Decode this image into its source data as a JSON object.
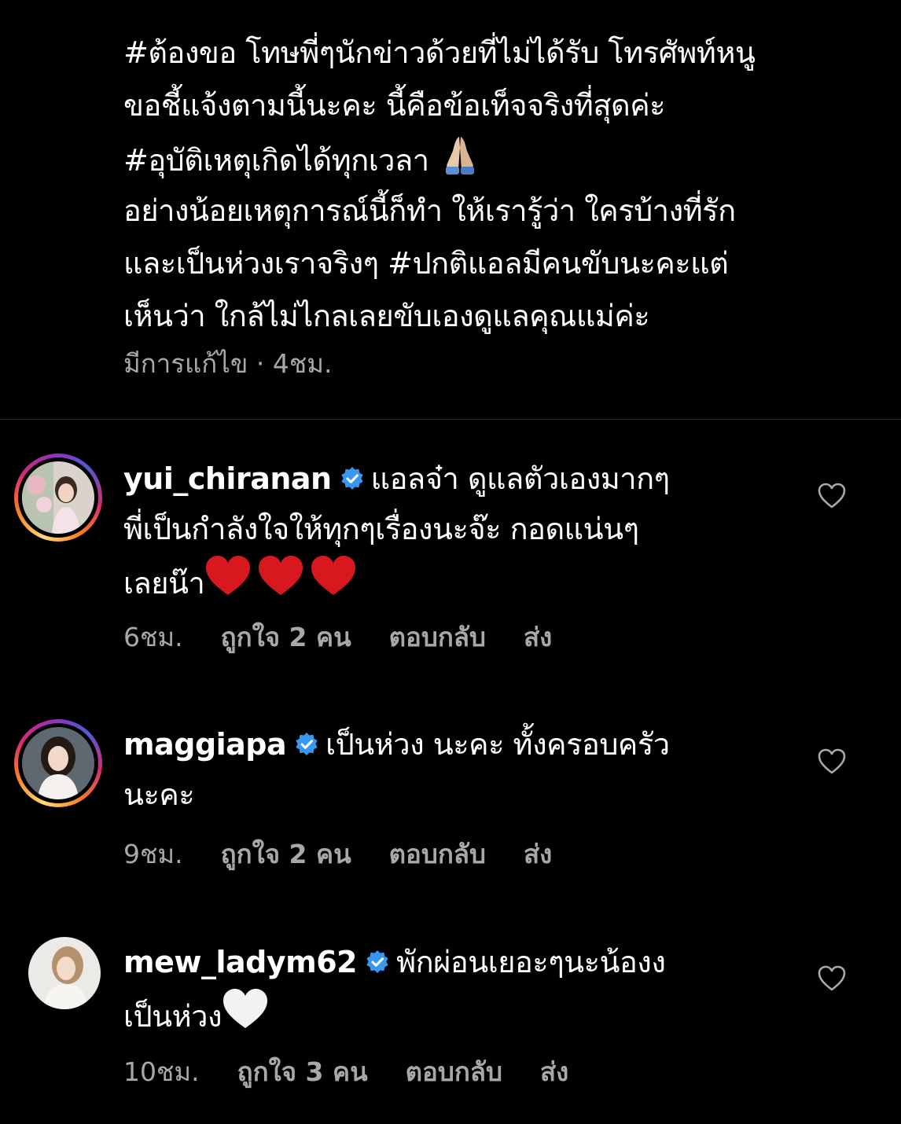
{
  "caption": {
    "lines": [
      "#ต้องขอ โทษพี่ๆนักข่าวด้วยที่ไม่ได้รับ โทรศัพท์หนู",
      "ขอชี้แจ้งตามนี้นะคะ นี้คือข้อเท็จจริงที่สุดค่ะ",
      "#อุบัติเหตุเกิดได้ทุกเวลา",
      "อย่างน้อยเหตุการณ์นี้ก็ทำ ให้เรารู้ว่า ใครบ้างที่รัก",
      "และเป็นห่วงเราจริงๆ #ปกติแอลมีคนขับนะคะแต่",
      "เห็นว่า ใกล้ไม่ไกลเลยขับเองดูแลคุณแม่ค่ะ"
    ],
    "emoji": "folded-hands",
    "meta": "มีการแก้ไข · 4ชม."
  },
  "comments": [
    {
      "username": "yui_chiranan",
      "verified": true,
      "line1": "แอลจ๋า ดูแลตัวเองมากๆ",
      "line2": "พี่เป็นกำลังใจให้ทุกๆเรื่องนะจ๊ะ กอดแน่นๆ",
      "line3": "เลยน๊า",
      "hearts": "red-heart x3",
      "time": "6ชม.",
      "likes": "ถูกใจ 2 คน",
      "reply": "ตอบกลับ",
      "send": "ส่ง",
      "story_ring": true
    },
    {
      "username": "maggiapa",
      "verified": true,
      "line1": "เป็นห่วง นะคะ ทั้งครอบครัว",
      "line2": "นะคะ",
      "time": "9ชม.",
      "likes": "ถูกใจ 2 คน",
      "reply": "ตอบกลับ",
      "send": "ส่ง",
      "story_ring": true
    },
    {
      "username": "mew_ladym62",
      "verified": true,
      "line1": "พักผ่อนเยอะๆนะน้องง",
      "line2": "เป็นห่วง",
      "hearts": "white-heart",
      "time": "10ชม.",
      "likes": "ถูกใจ 3 คน",
      "reply": "ตอบกลับ",
      "send": "ส่ง",
      "story_ring": false
    }
  ],
  "colors": {
    "background": "#000000",
    "text": "#ffffff",
    "secondary": "#a8a8a8",
    "verified": "#3897f0",
    "divider": "#262626"
  }
}
